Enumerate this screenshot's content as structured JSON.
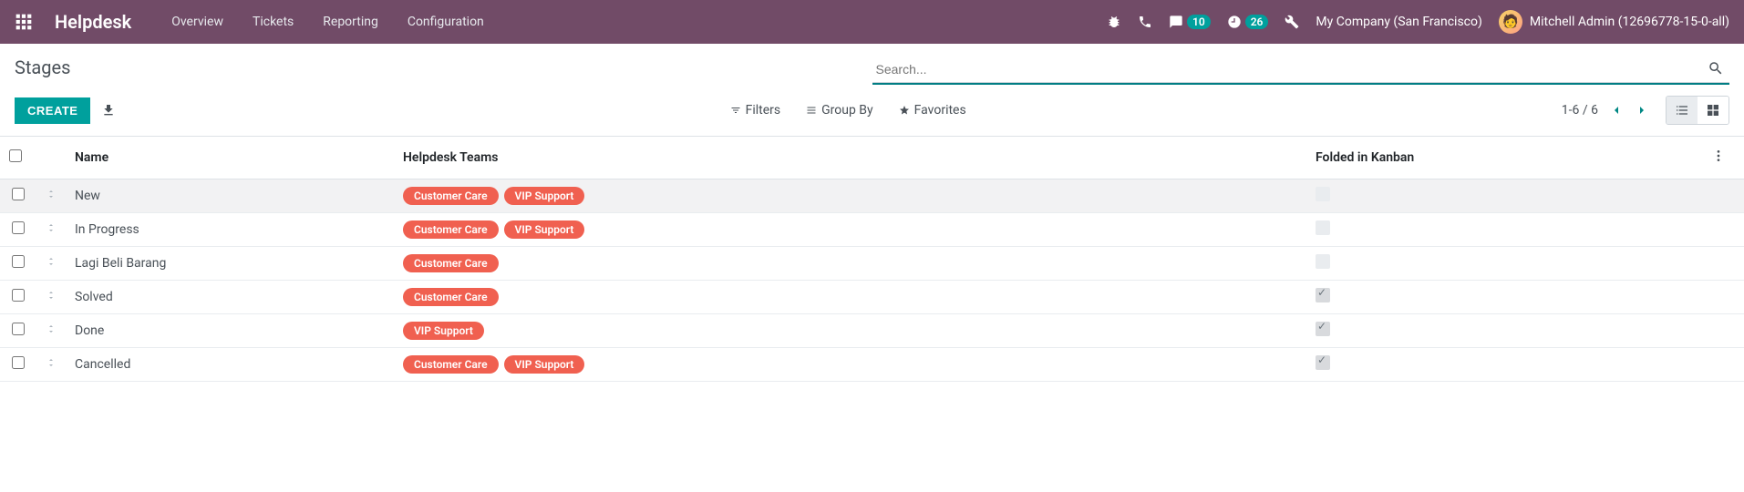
{
  "navbar": {
    "brand": "Helpdesk",
    "menu": [
      "Overview",
      "Tickets",
      "Reporting",
      "Configuration"
    ],
    "messages_count": "10",
    "activities_count": "26",
    "company": "My Company (San Francisco)",
    "user": "Mitchell Admin (12696778-15-0-all)"
  },
  "control_panel": {
    "title": "Stages",
    "search_placeholder": "Search...",
    "create_label": "CREATE",
    "filters_label": "Filters",
    "groupby_label": "Group By",
    "favorites_label": "Favorites",
    "pager_text": "1-6 / 6"
  },
  "columns": {
    "name": "Name",
    "teams": "Helpdesk Teams",
    "folded": "Folded in Kanban"
  },
  "tags": {
    "customer_care": "Customer Care",
    "vip_support": "VIP Support"
  },
  "rows": [
    {
      "name": "New",
      "teams": [
        "customer_care",
        "vip_support"
      ],
      "folded": false
    },
    {
      "name": "In Progress",
      "teams": [
        "customer_care",
        "vip_support"
      ],
      "folded": false
    },
    {
      "name": "Lagi Beli Barang",
      "teams": [
        "customer_care"
      ],
      "folded": false
    },
    {
      "name": "Solved",
      "teams": [
        "customer_care"
      ],
      "folded": true
    },
    {
      "name": "Done",
      "teams": [
        "vip_support"
      ],
      "folded": true
    },
    {
      "name": "Cancelled",
      "teams": [
        "customer_care",
        "vip_support"
      ],
      "folded": true
    }
  ]
}
